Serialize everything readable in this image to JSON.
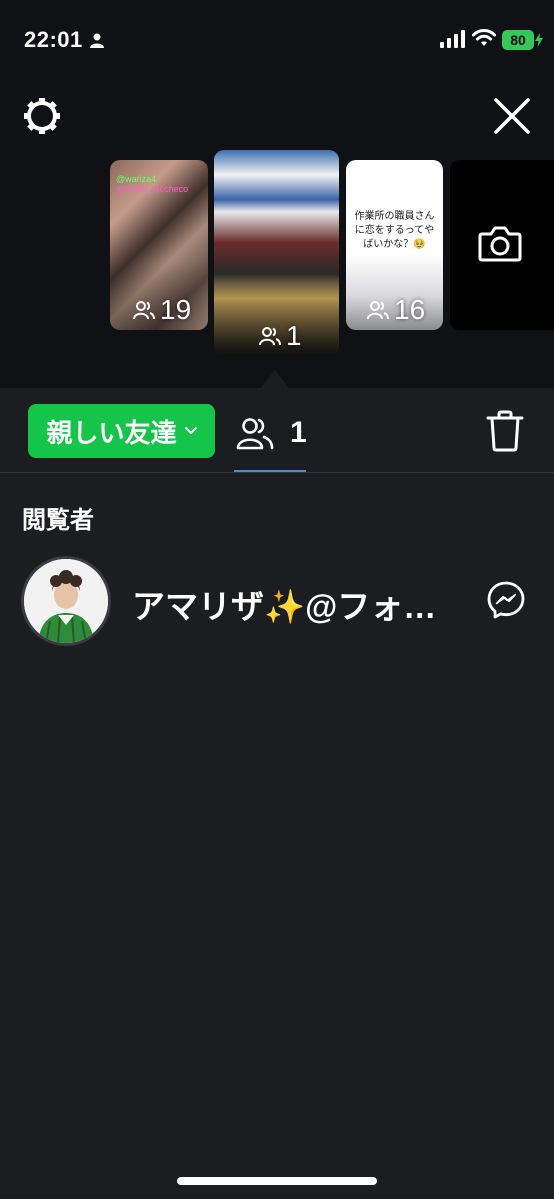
{
  "status_bar": {
    "time": "22:01",
    "battery": "80"
  },
  "top_bar": {
    "settings_icon": "gear-icon",
    "close_icon": "close-icon"
  },
  "stories": [
    {
      "id": 1,
      "tag1": "@wariza4",
      "tag2": "@mako_taccheco",
      "viewers": "19"
    },
    {
      "id": 2,
      "viewers": "1",
      "selected": true
    },
    {
      "id": 3,
      "caption": "作業所の職員さんに恋をするってやばいかな？🥹",
      "viewers": "16"
    },
    {
      "id": 4,
      "icon": "camera-icon"
    }
  ],
  "toolbar": {
    "audience_label": "親しい友達",
    "viewer_count": "1",
    "delete_icon": "trash-icon",
    "accent": "#15c549"
  },
  "viewers_section": {
    "title": "閲覧者",
    "viewers": [
      {
        "name": "アマリザ✨@フォ…",
        "action_icon": "messenger-icon"
      }
    ]
  }
}
